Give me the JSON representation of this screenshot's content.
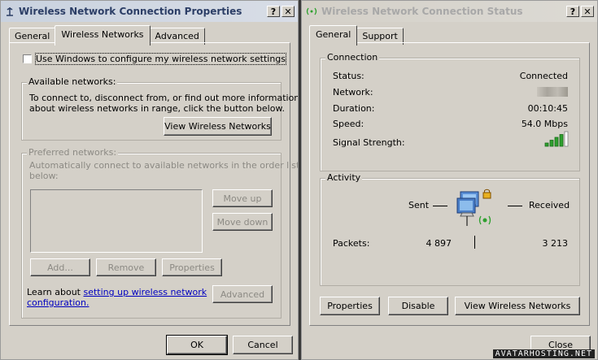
{
  "left_dialog": {
    "title": "Wireless Network Connection Properties",
    "help_btn": "?",
    "close_btn": "✕",
    "tabs": [
      "General",
      "Wireless Networks",
      "Advanced"
    ],
    "use_windows_label": "Use Windows to configure my wireless network settings",
    "use_windows_checked": false,
    "available_networks": {
      "label": "Available networks:",
      "line1": "To connect to, disconnect from, or find out more information",
      "line2": "about wireless networks in range, click the button below.",
      "view_button": "View Wireless Networks"
    },
    "preferred_networks": {
      "label": "Preferred networks:",
      "line1": "Automatically connect to available networks in the order listed",
      "line2": "below:",
      "move_up": "Move up",
      "move_down": "Move down",
      "add": "Add...",
      "remove": "Remove",
      "properties": "Properties"
    },
    "learn_about_prefix": "Learn about ",
    "learn_link_line1": "setting up wireless network",
    "learn_link_line2": "configuration.",
    "advanced_button": "Advanced",
    "ok": "OK",
    "cancel": "Cancel"
  },
  "right_dialog": {
    "title": "Wireless Network Connection Status",
    "help_btn": "?",
    "close_btn": "✕",
    "tabs": [
      "General",
      "Support"
    ],
    "connection": {
      "label": "Connection",
      "status_label": "Status:",
      "status_value": "Connected",
      "network_label": "Network:",
      "duration_label": "Duration:",
      "duration_value": "00:10:45",
      "speed_label": "Speed:",
      "speed_value": "54.0 Mbps",
      "signal_label": "Signal Strength:",
      "signal_bars_lit": 4,
      "signal_bars_total": 5
    },
    "activity": {
      "label": "Activity",
      "sent": "Sent",
      "received": "Received",
      "packets_label": "Packets:",
      "packets_sent": "4 897",
      "packets_received": "3 213"
    },
    "properties": "Properties",
    "disable": "Disable",
    "view_networks": "View Wireless Networks",
    "close": "Close"
  },
  "watermark": "AVATARHOSTING.NET",
  "colors": {
    "face": "#d4d0c8",
    "link": "#0000c0",
    "signal_green": "#2ea02e"
  }
}
